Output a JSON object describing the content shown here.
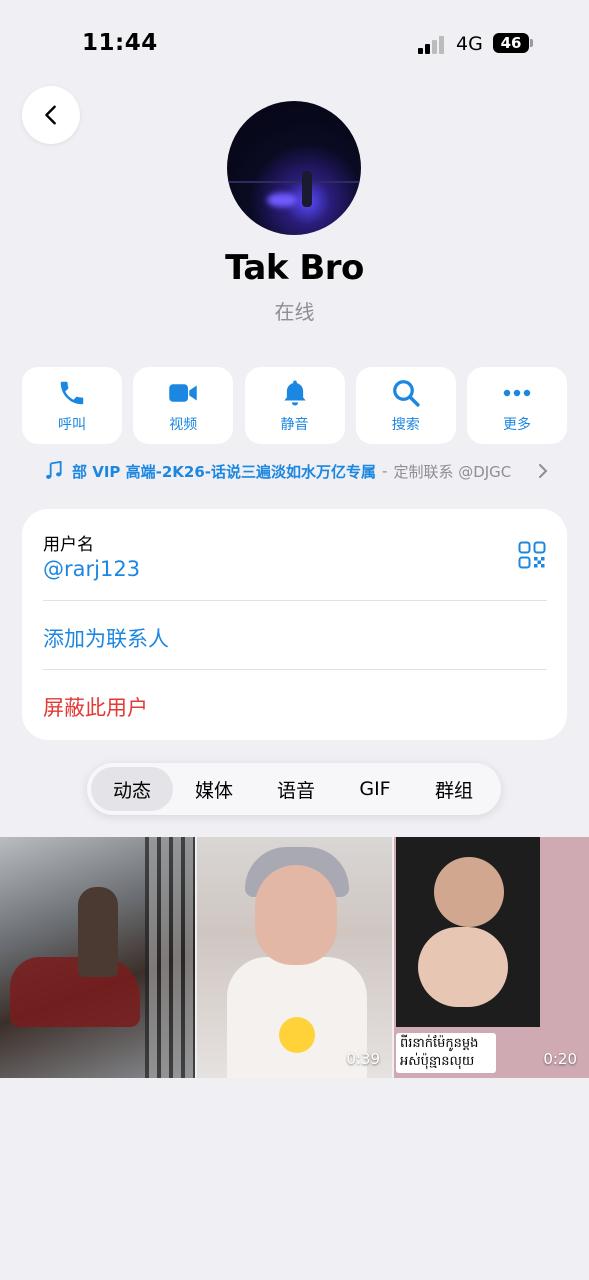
{
  "status_bar": {
    "time": "11:44",
    "network": "4G",
    "battery": "46"
  },
  "profile": {
    "name": "Tak Bro",
    "status": "在线"
  },
  "actions": [
    {
      "label": "呼叫",
      "icon": "phone-icon"
    },
    {
      "label": "视频",
      "icon": "video-camera-icon"
    },
    {
      "label": "静音",
      "icon": "bell-icon"
    },
    {
      "label": "搜索",
      "icon": "search-icon"
    },
    {
      "label": "更多",
      "icon": "more-dots-icon"
    }
  ],
  "music": {
    "title": "部 VIP 高端-2K26-话说三遍淡如水万亿专属",
    "subtitle": "定制联系 @DJGC"
  },
  "info": {
    "username_label": "用户名",
    "username_value": "@rarj123",
    "add_contact": "添加为联系人",
    "block_user": "屏蔽此用户"
  },
  "tabs": [
    {
      "label": "动态",
      "active": true
    },
    {
      "label": "媒体",
      "active": false
    },
    {
      "label": "语音",
      "active": false
    },
    {
      "label": "GIF",
      "active": false
    },
    {
      "label": "群组",
      "active": false
    }
  ],
  "media": [
    {
      "duration": ""
    },
    {
      "duration": "0:39"
    },
    {
      "duration": "0:20",
      "caption": "ពីរនាក់ម៉ែកូនម្តង អស់ប៉ុន្មានលុយ"
    }
  ],
  "colors": {
    "accent": "#1c87e0",
    "danger": "#e53935",
    "background": "#efeff4"
  }
}
